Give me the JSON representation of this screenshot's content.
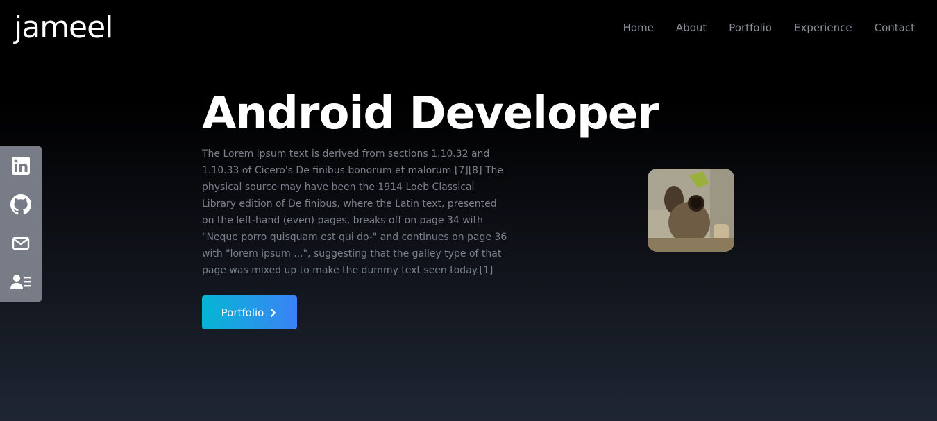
{
  "brand": {
    "logo_text": "jameel"
  },
  "nav": {
    "items": [
      {
        "label": "Home"
      },
      {
        "label": "About"
      },
      {
        "label": "Portfolio"
      },
      {
        "label": "Experience"
      },
      {
        "label": "Contact"
      }
    ]
  },
  "social": {
    "items": [
      {
        "icon": "linkedin-icon"
      },
      {
        "icon": "github-icon"
      },
      {
        "icon": "mail-icon"
      },
      {
        "icon": "resume-icon"
      }
    ]
  },
  "hero": {
    "title": "Android Developer",
    "description": "The Lorem ipsum text is derived from sections 1.10.32 and 1.10.33 of Cicero's De finibus bonorum et malorum.[7][8] The physical source may have been the 1914 Loeb Classical Library edition of De finibus, where the Latin text, presented on the left-hand (even) pages, breaks off on page 34 with \"Neque porro quisquam est qui do-\" and continues on page 36 with \"lorem ipsum ...\", suggesting that the galley type of that page was mixed up to make the dummy text seen today.[1]",
    "button_label": "Portfolio",
    "button_icon": "chevron-right-icon"
  },
  "colors": {
    "background_top": "#000000",
    "background_bottom": "#1f2633",
    "nav_text": "#8b8f99",
    "body_text": "#7a808c",
    "social_bar": "#777c86",
    "button_gradient_start": "#06b6d4",
    "button_gradient_end": "#3b82f6"
  }
}
